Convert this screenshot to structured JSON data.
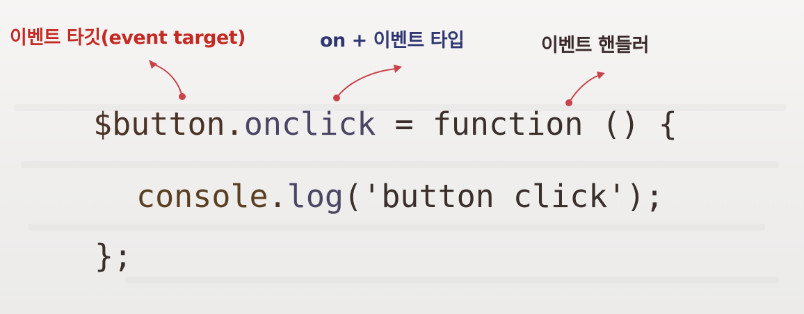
{
  "annotations": {
    "event_target": {
      "text": "이벤트 타깃(event target)",
      "color": "#c42a24"
    },
    "event_type": {
      "text": "on + 이벤트 타입",
      "color": "#2f3672"
    },
    "event_handler": {
      "text": "이벤트 핸들러",
      "color": "#3a2a2a"
    }
  },
  "leader_color": "#c8434a",
  "code": {
    "line1": {
      "variable": "$button",
      "dot": ".",
      "property": "onclick",
      "assign": " = ",
      "keyword": "function",
      "params": " () {"
    },
    "line2": {
      "object": "console",
      "dot": ".",
      "method": "log",
      "open": "(",
      "string": "'button click'",
      "close": ");"
    },
    "line3": {
      "text": "};"
    }
  }
}
